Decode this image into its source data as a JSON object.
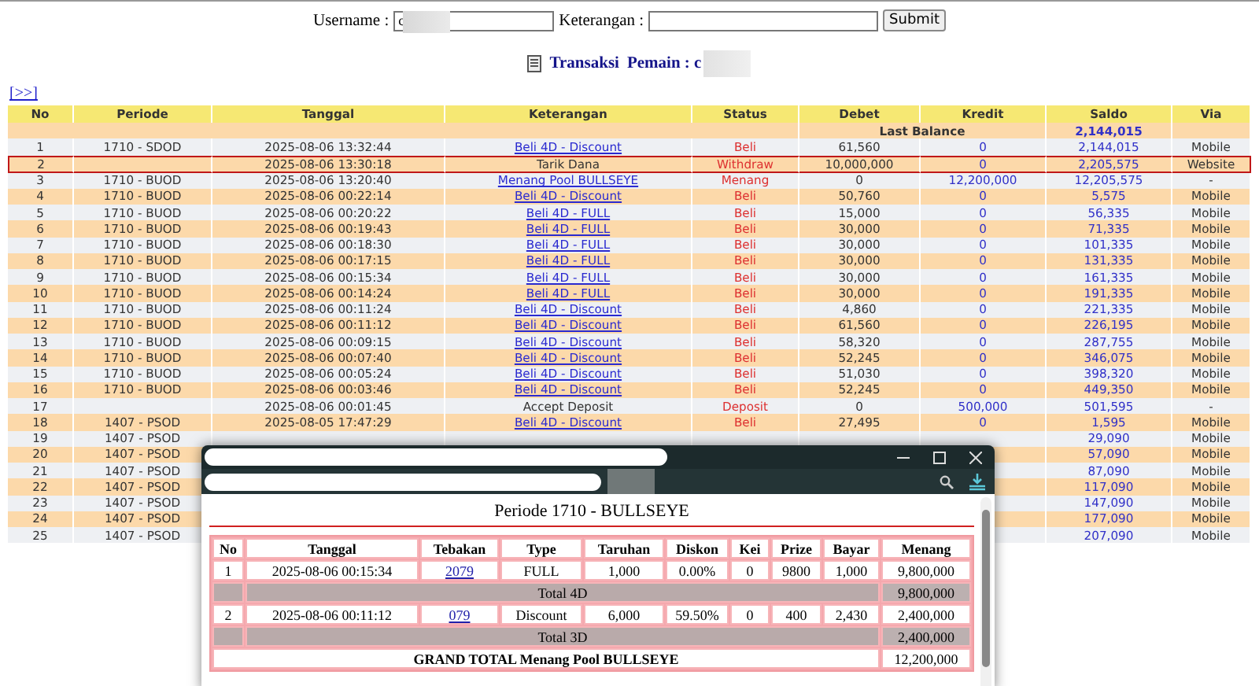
{
  "search_form": {
    "username_label": "Username :",
    "username_value": "c",
    "keterangan_label": "Keterangan :",
    "submit": "Submit"
  },
  "heading": {
    "title": "Transaksi",
    "player_label": "Pemain : c"
  },
  "next_link": "[>>]",
  "table": {
    "columns": [
      "No",
      "Periode",
      "Tanggal",
      "Keterangan",
      "Status",
      "Debet",
      "Kredit",
      "Saldo",
      "Via"
    ],
    "last_balance": {
      "label": "Last Balance",
      "saldo": "2,144,015"
    },
    "rows": [
      {
        "no": "1",
        "periode": "1710 - SDOD",
        "tanggal": "2025-08-06 13:32:44",
        "keterangan": "Beli 4D - Discount",
        "keterangan_link": true,
        "status": "Beli",
        "debet": "61,560",
        "kredit": "0",
        "saldo": "2,144,015",
        "via": "Mobile",
        "highlighted": false
      },
      {
        "no": "2",
        "tanggal": "2025-08-06 13:30:18",
        "keterangan": "Tarik Dana",
        "keterangan_link": false,
        "status": "Withdraw",
        "debet": "10,000,000",
        "kredit": "0",
        "saldo": "2,205,575",
        "via": "Website",
        "highlighted": true
      },
      {
        "no": "3",
        "periode": "1710 - BUOD",
        "tanggal": "2025-08-06 13:20:40",
        "keterangan": "Menang Pool BULLSEYE",
        "keterangan_link": true,
        "status": "Menang",
        "debet": "0",
        "kredit": "12,200,000",
        "saldo": "12,205,575",
        "via": "-",
        "highlighted": false
      },
      {
        "no": "4",
        "periode": "1710 - BUOD",
        "tanggal": "2025-08-06 00:22:14",
        "keterangan": "Beli 4D - Discount",
        "keterangan_link": true,
        "status": "Beli",
        "debet": "50,760",
        "kredit": "0",
        "saldo": "5,575",
        "via": "Mobile",
        "highlighted": false
      },
      {
        "no": "5",
        "periode": "1710 - BUOD",
        "tanggal": "2025-08-06 00:20:22",
        "keterangan": "Beli 4D - FULL",
        "keterangan_link": true,
        "status": "Beli",
        "debet": "15,000",
        "kredit": "0",
        "saldo": "56,335",
        "via": "Mobile",
        "highlighted": false
      },
      {
        "no": "6",
        "periode": "1710 - BUOD",
        "tanggal": "2025-08-06 00:19:43",
        "keterangan": "Beli 4D - FULL",
        "keterangan_link": true,
        "status": "Beli",
        "debet": "30,000",
        "kredit": "0",
        "saldo": "71,335",
        "via": "Mobile",
        "highlighted": false
      },
      {
        "no": "7",
        "periode": "1710 - BUOD",
        "tanggal": "2025-08-06 00:18:30",
        "keterangan": "Beli 4D - FULL",
        "keterangan_link": true,
        "status": "Beli",
        "debet": "30,000",
        "kredit": "0",
        "saldo": "101,335",
        "via": "Mobile",
        "highlighted": false
      },
      {
        "no": "8",
        "periode": "1710 - BUOD",
        "tanggal": "2025-08-06 00:17:15",
        "keterangan": "Beli 4D - FULL",
        "keterangan_link": true,
        "status": "Beli",
        "debet": "30,000",
        "kredit": "0",
        "saldo": "131,335",
        "via": "Mobile",
        "highlighted": false
      },
      {
        "no": "9",
        "periode": "1710 - BUOD",
        "tanggal": "2025-08-06 00:15:34",
        "keterangan": "Beli 4D - FULL",
        "keterangan_link": true,
        "status": "Beli",
        "debet": "30,000",
        "kredit": "0",
        "saldo": "161,335",
        "via": "Mobile",
        "highlighted": false
      },
      {
        "no": "10",
        "periode": "1710 - BUOD",
        "tanggal": "2025-08-06 00:14:24",
        "keterangan": "Beli 4D - FULL",
        "keterangan_link": true,
        "status": "Beli",
        "debet": "30,000",
        "kredit": "0",
        "saldo": "191,335",
        "via": "Mobile",
        "highlighted": false
      },
      {
        "no": "11",
        "periode": "1710 - BUOD",
        "tanggal": "2025-08-06 00:11:24",
        "keterangan": "Beli 4D - Discount",
        "keterangan_link": true,
        "status": "Beli",
        "debet": "4,860",
        "kredit": "0",
        "saldo": "221,335",
        "via": "Mobile",
        "highlighted": false
      },
      {
        "no": "12",
        "periode": "1710 - BUOD",
        "tanggal": "2025-08-06 00:11:12",
        "keterangan": "Beli 4D - Discount",
        "keterangan_link": true,
        "status": "Beli",
        "debet": "61,560",
        "kredit": "0",
        "saldo": "226,195",
        "via": "Mobile",
        "highlighted": false
      },
      {
        "no": "13",
        "periode": "1710 - BUOD",
        "tanggal": "2025-08-06 00:09:15",
        "keterangan": "Beli 4D - Discount",
        "keterangan_link": true,
        "status": "Beli",
        "debet": "58,320",
        "kredit": "0",
        "saldo": "287,755",
        "via": "Mobile",
        "highlighted": false
      },
      {
        "no": "14",
        "periode": "1710 - BUOD",
        "tanggal": "2025-08-06 00:07:40",
        "keterangan": "Beli 4D - Discount",
        "keterangan_link": true,
        "status": "Beli",
        "debet": "52,245",
        "kredit": "0",
        "saldo": "346,075",
        "via": "Mobile",
        "highlighted": false
      },
      {
        "no": "15",
        "periode": "1710 - BUOD",
        "tanggal": "2025-08-06 00:05:24",
        "keterangan": "Beli 4D - Discount",
        "keterangan_link": true,
        "status": "Beli",
        "debet": "51,030",
        "kredit": "0",
        "saldo": "398,320",
        "via": "Mobile",
        "highlighted": false
      },
      {
        "no": "16",
        "periode": "1710 - BUOD",
        "tanggal": "2025-08-06 00:03:46",
        "keterangan": "Beli 4D - Discount",
        "keterangan_link": true,
        "status": "Beli",
        "debet": "52,245",
        "kredit": "0",
        "saldo": "449,350",
        "via": "Mobile",
        "highlighted": false
      },
      {
        "no": "17",
        "tanggal": "2025-08-06 00:01:45",
        "keterangan": "Accept Deposit",
        "keterangan_link": false,
        "status": "Deposit",
        "debet": "0",
        "kredit": "500,000",
        "saldo": "501,595",
        "via": "-",
        "highlighted": false
      },
      {
        "no": "18",
        "periode": "1407 - PSOD",
        "tanggal": "2025-08-05 17:47:29",
        "keterangan": "Beli 4D - Discount",
        "keterangan_link": true,
        "status": "Beli",
        "debet": "27,495",
        "kredit": "0",
        "saldo": "1,595",
        "via": "Mobile",
        "highlighted": false
      },
      {
        "no": "19",
        "periode": "1407 - PSOD",
        "saldo": "29,090",
        "via": "Mobile",
        "highlighted": false
      },
      {
        "no": "20",
        "periode": "1407 - PSOD",
        "saldo": "57,090",
        "via": "Mobile",
        "highlighted": false
      },
      {
        "no": "21",
        "periode": "1407 - PSOD",
        "saldo": "87,090",
        "via": "Mobile",
        "highlighted": false
      },
      {
        "no": "22",
        "periode": "1407 - PSOD",
        "saldo": "117,090",
        "via": "Mobile",
        "highlighted": false
      },
      {
        "no": "23",
        "periode": "1407 - PSOD",
        "saldo": "147,090",
        "via": "Mobile",
        "highlighted": false
      },
      {
        "no": "24",
        "periode": "1407 - PSOD",
        "saldo": "177,090",
        "via": "Mobile",
        "highlighted": false
      },
      {
        "no": "25",
        "periode": "1407 - PSOD",
        "saldo": "207,090",
        "via": "Mobile",
        "highlighted": false
      }
    ]
  },
  "popup": {
    "title": "Periode 1710 - BULLSEYE",
    "columns": [
      "No",
      "Tanggal",
      "Tebakan",
      "Type",
      "Taruhan",
      "Diskon",
      "Kei",
      "Prize",
      "Bayar",
      "Menang"
    ],
    "rows": [
      {
        "kind": "bet",
        "no": "1",
        "tanggal": "2025-08-06 00:15:34",
        "tebakan": "2079",
        "type": "FULL",
        "taruhan": "1,000",
        "diskon": "0.00%",
        "kei": "0",
        "prize": "9800",
        "bayar": "1,000",
        "menang": "9,800,000"
      },
      {
        "kind": "subtotal",
        "label": "Total 4D",
        "menang": "9,800,000"
      },
      {
        "kind": "bet",
        "no": "2",
        "tanggal": "2025-08-06 00:11:12",
        "tebakan": "079",
        "type": "Discount",
        "taruhan": "6,000",
        "diskon": "59.50%",
        "kei": "0",
        "prize": "400",
        "bayar": "2,430",
        "menang": "2,400,000"
      },
      {
        "kind": "subtotal",
        "label": "Total 3D",
        "menang": "2,400,000"
      },
      {
        "kind": "grand_total",
        "label": "GRAND TOTAL  Menang Pool BULLSEYE",
        "menang": "12,200,000"
      }
    ]
  }
}
